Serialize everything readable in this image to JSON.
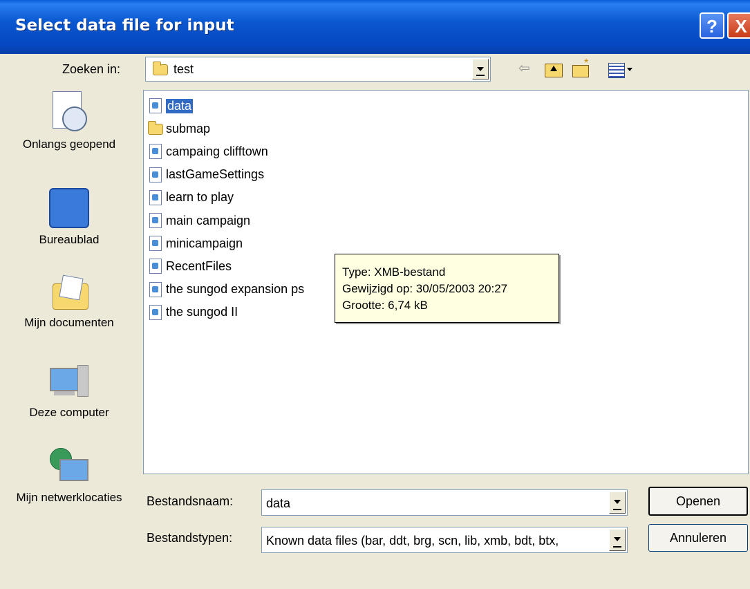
{
  "window": {
    "title": "Select data file for input",
    "help_label": "?",
    "close_label": "X"
  },
  "lookin": {
    "label": "Zoeken in:",
    "value": "test"
  },
  "toolbar": {
    "icons": [
      "back-icon",
      "up-folder-icon",
      "new-folder-icon",
      "view-menu-icon"
    ]
  },
  "places": [
    {
      "label": "Onlangs geopend",
      "icon": "recent-icon"
    },
    {
      "label": "Bureaublad",
      "icon": "desktop-icon"
    },
    {
      "label": "Mijn documenten",
      "icon": "my-documents-icon"
    },
    {
      "label": "Deze computer",
      "icon": "my-computer-icon"
    },
    {
      "label": "Mijn netwerklocaties",
      "icon": "network-icon"
    }
  ],
  "files": [
    {
      "name": "data",
      "type": "file",
      "selected": true
    },
    {
      "name": "submap",
      "type": "folder"
    },
    {
      "name": "campaing clifftown",
      "type": "file"
    },
    {
      "name": "lastGameSettings",
      "type": "file"
    },
    {
      "name": "learn to play",
      "type": "file"
    },
    {
      "name": "main campaign",
      "type": "file"
    },
    {
      "name": "minicampaign",
      "type": "file"
    },
    {
      "name": "RecentFiles",
      "type": "file"
    },
    {
      "name": "the sungod expansion ps",
      "type": "file"
    },
    {
      "name": "the sungod II",
      "type": "file"
    }
  ],
  "tooltip": {
    "type": "Type: XMB-bestand",
    "modified": "Gewijzigd op: 30/05/2003 20:27",
    "size": "Grootte: 6,74 kB"
  },
  "filename": {
    "label": "Bestandsnaam:",
    "value": "data"
  },
  "filetype": {
    "label": "Bestandstypen:",
    "value": "Known data files (bar, ddt, brg, scn, lib, xmb, bdt, btx,"
  },
  "buttons": {
    "open": "Openen",
    "cancel": "Annuleren"
  }
}
